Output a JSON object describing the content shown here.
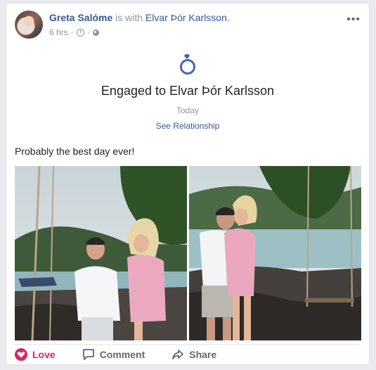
{
  "post": {
    "author": "Greta Salóme",
    "with_text": "is with",
    "tagged": "Elvar Þór Karlsson.",
    "time": "6 hrs",
    "separator": "·",
    "more_label": "•••",
    "life_event": {
      "icon": "ring-icon",
      "title": "Engaged to Elvar Þór Karlsson",
      "date": "Today",
      "link": "See Relationship"
    },
    "text": "Probably the best day ever!",
    "photos": [
      {
        "name": "proposal-photo-left",
        "description": ""
      },
      {
        "name": "proposal-photo-right",
        "description": ""
      }
    ],
    "actions": [
      {
        "name": "love-button",
        "label": "Love",
        "active": true
      },
      {
        "name": "comment-button",
        "label": "Comment"
      },
      {
        "name": "share-button",
        "label": "Share"
      }
    ]
  },
  "colors": {
    "link": "#365899",
    "love": "#e0245e",
    "accent": "#4267b2",
    "muted": "#90949c"
  }
}
